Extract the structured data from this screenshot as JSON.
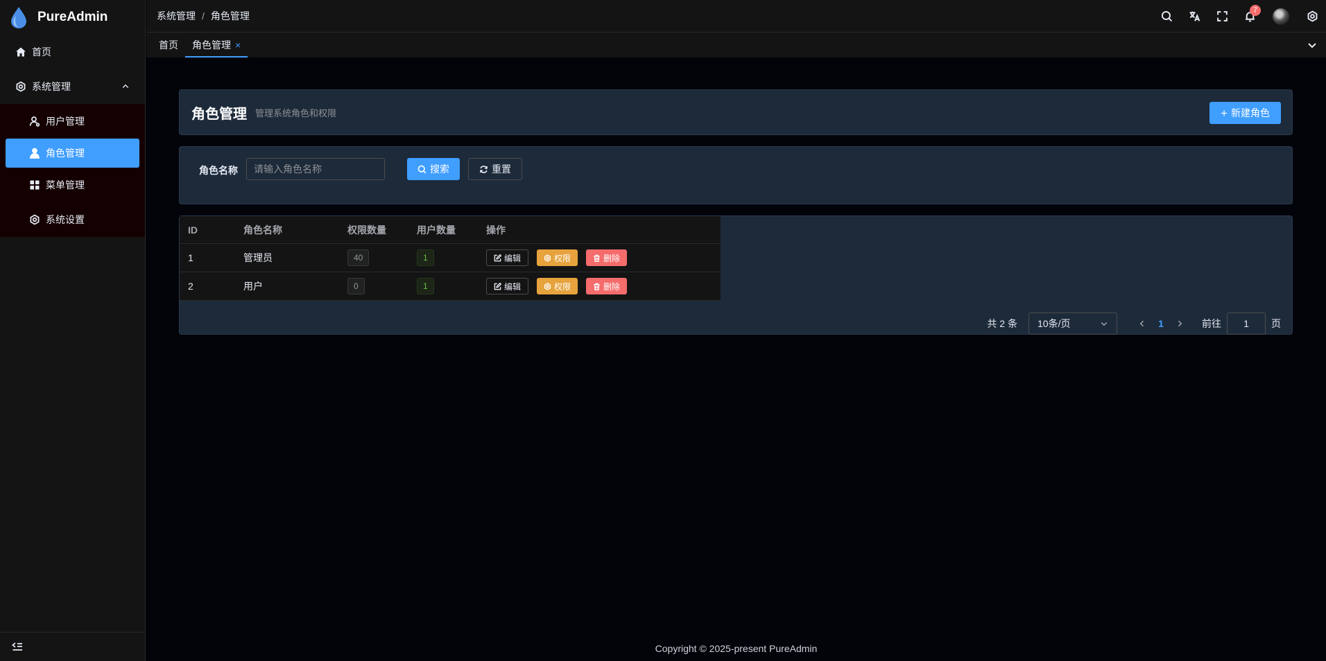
{
  "app": {
    "title": "PureAdmin"
  },
  "sidebar": {
    "home": "首页",
    "group": "系统管理",
    "items": [
      {
        "label": "用户管理"
      },
      {
        "label": "角色管理"
      },
      {
        "label": "菜单管理"
      },
      {
        "label": "系统设置"
      }
    ]
  },
  "breadcrumb": {
    "parent": "系统管理",
    "separator": "/",
    "current": "角色管理"
  },
  "header": {
    "notification_count": "7"
  },
  "tabs": [
    {
      "label": "首页"
    },
    {
      "label": "角色管理",
      "close": "×"
    }
  ],
  "page": {
    "title": "角色管理",
    "subtitle": "管理系统角色和权限",
    "create_button": "新建角色"
  },
  "search": {
    "label": "角色名称",
    "placeholder": "请输入角色名称",
    "search_button": "搜索",
    "reset_button": "重置"
  },
  "table": {
    "columns": [
      "ID",
      "角色名称",
      "权限数量",
      "用户数量",
      "操作"
    ],
    "rows": [
      {
        "id": "1",
        "name": "管理员",
        "perm_count": "40",
        "user_count": "1"
      },
      {
        "id": "2",
        "name": "用户",
        "perm_count": "0",
        "user_count": "1"
      }
    ],
    "actions": {
      "edit": "编辑",
      "perm": "权限",
      "delete": "删除"
    }
  },
  "pagination": {
    "total": "共 2 条",
    "page_size": "10条/页",
    "current": "1",
    "goto_label": "前往",
    "goto_value": "1",
    "page_suffix": "页"
  },
  "footer": {
    "copyright": "Copyright © 2025-present PureAdmin"
  },
  "colors": {
    "primary": "#409eff",
    "warning": "#e6a23c",
    "danger": "#f56c6c",
    "success": "#67c23a"
  }
}
